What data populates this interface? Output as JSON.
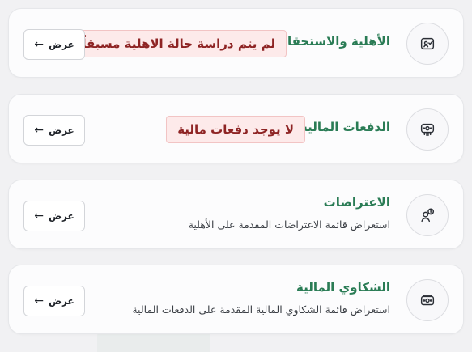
{
  "cards": [
    {
      "title": "الأهلية والاستحقاق",
      "badge": "لم يتم دراسة حالة الاهلية مسبقاً",
      "button_label": "عرض",
      "button_arrow": "←",
      "icon": "verified-id-icon"
    },
    {
      "title": "الدفعات المالية",
      "badge": "لا يوجد دفعات مالية",
      "button_label": "عرض",
      "button_arrow": "←",
      "icon": "money-icon"
    },
    {
      "title": "الاعتراضات",
      "subtitle": "استعراض قائمة الاعتراضات المقدمة على الأهلية",
      "button_label": "عرض",
      "button_arrow": "←",
      "icon": "user-alert-icon"
    },
    {
      "title": "الشكاوي المالية",
      "subtitle": "استعراض قائمة الشكاوي المالية المقدمة على الدفعات المالية",
      "button_label": "عرض",
      "button_arrow": "←",
      "icon": "cash-complaint-icon"
    }
  ],
  "colors": {
    "title": "#2a7c55",
    "badge_bg": "#fdeaea",
    "badge_text": "#8e2424",
    "card_bg": "#fcfcfd"
  }
}
